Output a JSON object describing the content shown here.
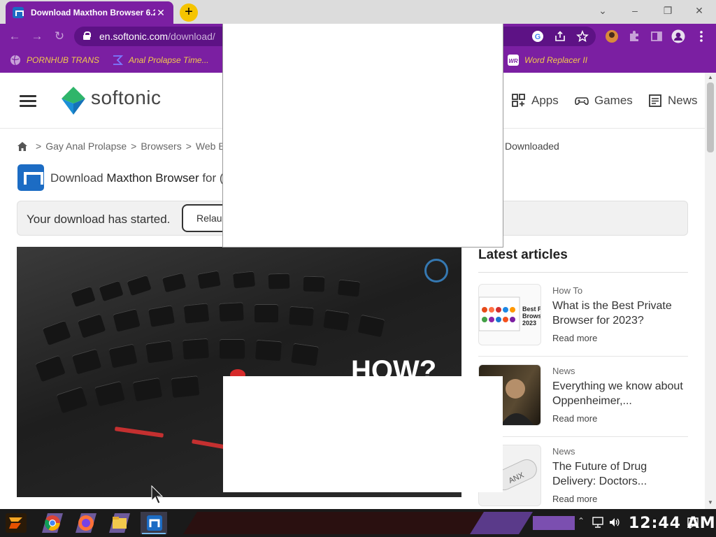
{
  "browser": {
    "tab_title": "Download Maxthon Browser 6.2",
    "tab_close": "✕",
    "new_tab": "+",
    "url_host": "en.softonic.com",
    "url_path": "/download/",
    "window_controls": [
      "⌄",
      "–",
      "❐",
      "✕"
    ]
  },
  "bookmarks": [
    {
      "label": "PORNHUB TRANS",
      "icon": "globe-icon"
    },
    {
      "label": "Anal Prolapse Time...",
      "icon": "bracket-icon"
    },
    {
      "label": "Word Replacer II",
      "icon": "wr-icon"
    }
  ],
  "site": {
    "logo_text": "softonic",
    "nav": [
      {
        "label": "Apps",
        "icon": "apps-icon"
      },
      {
        "label": "Games",
        "icon": "gamepad-icon"
      },
      {
        "label": "News",
        "icon": "news-icon"
      }
    ],
    "breadcrumb": [
      "Gay Anal Prolapse",
      "Browsers",
      "Web Br"
    ],
    "breadcrumb_sep": ">",
    "breadcrumb_tail": "Downloaded",
    "app_title_prefix": "Download ",
    "app_title_name": "Maxthon Browser",
    "app_title_suffix": " for (",
    "download_message": "Your download has started.",
    "relaunch_label": "Relaunch download",
    "hero_text": "HOW?"
  },
  "latest": {
    "heading": "Latest articles",
    "articles": [
      {
        "category": "How To",
        "title": "What is the Best Private Browser for 2023?",
        "more": "Read more",
        "thumb_text": "Best P Brows 2023"
      },
      {
        "category": "News",
        "title": "Everything we know about Oppenheimer,...",
        "more": "Read more",
        "thumb_text": ""
      },
      {
        "category": "News",
        "title": "The Future of Drug Delivery: Doctors...",
        "more": "Read more",
        "thumb_text": "ANX"
      }
    ]
  },
  "taskbar": {
    "clock": "12:44 AM"
  },
  "colors": {
    "browser_purple": "#7b1fa2",
    "omnibox": "#5d1285",
    "bookmark_text": "#f2c94c",
    "softonic_green": "#2fb56a",
    "softonic_blue": "#1a8fd6",
    "maxthon_blue": "#1c6cc4"
  }
}
